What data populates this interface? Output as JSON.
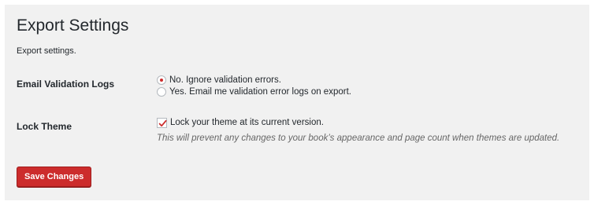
{
  "page": {
    "title": "Export Settings",
    "description": "Export settings."
  },
  "email_validation": {
    "label": "Email Validation Logs",
    "options": [
      {
        "label": "No. Ignore validation errors.",
        "selected": true
      },
      {
        "label": "Yes. Email me validation error logs on export.",
        "selected": false
      }
    ]
  },
  "lock_theme": {
    "label": "Lock Theme",
    "checkbox_label": "Lock your theme at its current version.",
    "checked": true,
    "description": "This will prevent any changes to your book’s appearance and page count when themes are updated."
  },
  "actions": {
    "save_label": "Save Changes"
  },
  "colors": {
    "accent": "#cc2c2c",
    "panel_bg": "#f1f1f1",
    "text": "#23282d",
    "muted_text": "#666666"
  },
  "icons": {
    "radio_selected": "radio-selected-icon",
    "radio_unselected": "radio-unselected-icon",
    "checkmark": "checkmark-icon"
  }
}
